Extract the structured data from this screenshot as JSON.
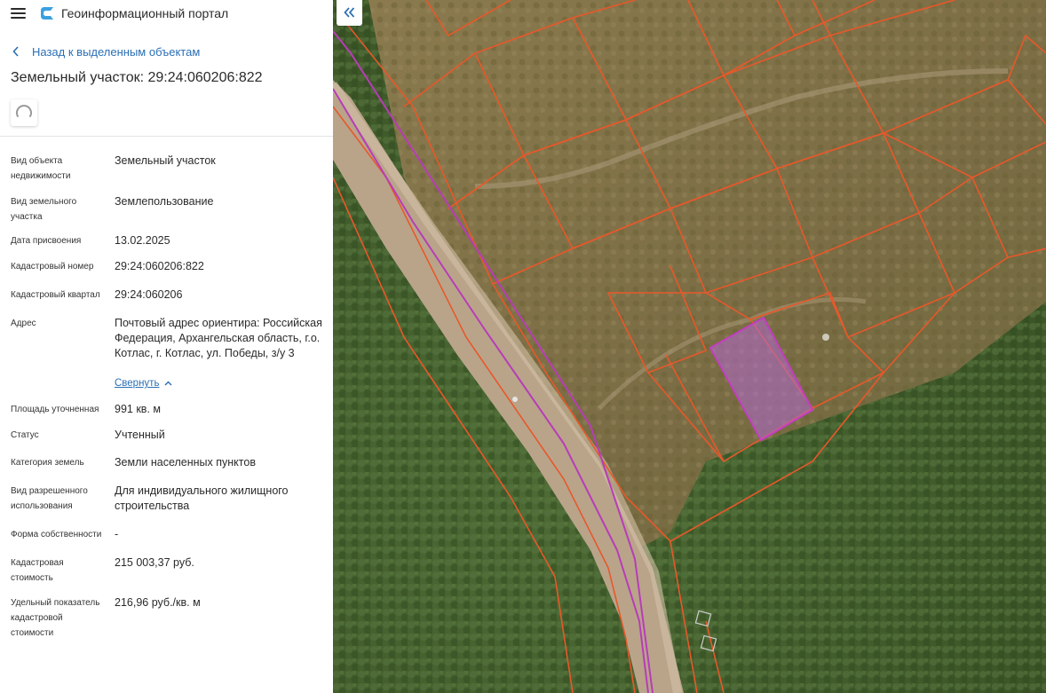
{
  "header": {
    "app_title": "Геоинформационный портал",
    "menu_icon": "hamburger-menu-icon",
    "logo_icon": "portal-logo-icon"
  },
  "back_link": {
    "label": "Назад к выделенным объектам",
    "icon": "chevron-left-icon"
  },
  "object": {
    "title": "Земельный участок: 29:24:060206:822",
    "thumbnail_state": "loading"
  },
  "properties": [
    {
      "label": "Вид объекта недвижимости",
      "value": "Земельный участок"
    },
    {
      "label": "Вид земельного участка",
      "value": "Землепользование"
    },
    {
      "label": "Дата присвоения",
      "value": "13.02.2025"
    },
    {
      "label": "Кадастровый номер",
      "value": "29:24:060206:822"
    },
    {
      "label": "Кадастровый квартал",
      "value": "29:24:060206"
    },
    {
      "label": "Адрес",
      "value": "Почтовый адрес ориентира: Российская Федерация, Архангельская область, г.о. Котлас, г. Котлас, ул. Победы, з/у 3"
    },
    {
      "label": "Площадь уточненная",
      "value": "991 кв. м"
    },
    {
      "label": "Статус",
      "value": "Учтенный"
    },
    {
      "label": "Категория земель",
      "value": "Земли населенных пунктов"
    },
    {
      "label": "Вид разрешенного использования",
      "value": "Для индивидуального жилищного строительства"
    },
    {
      "label": "Форма собственности",
      "value": "-"
    },
    {
      "label": "Кадастровая стоимость",
      "value": "215 003,37 руб."
    },
    {
      "label": "Удельный показатель кадастровой стоимости",
      "value": "216,96 руб./кв. м"
    }
  ],
  "address_toggle": {
    "label": "Свернуть",
    "icon": "chevron-up-icon"
  },
  "map": {
    "collapse_button_icon": "double-chevron-left-icon",
    "colors": {
      "parcel_border": "#e8582a",
      "selected_fill": "#b46ad2",
      "selected_border": "#c23ec2",
      "road_line": "#b83cb8",
      "link": "#2b6fb5"
    }
  }
}
